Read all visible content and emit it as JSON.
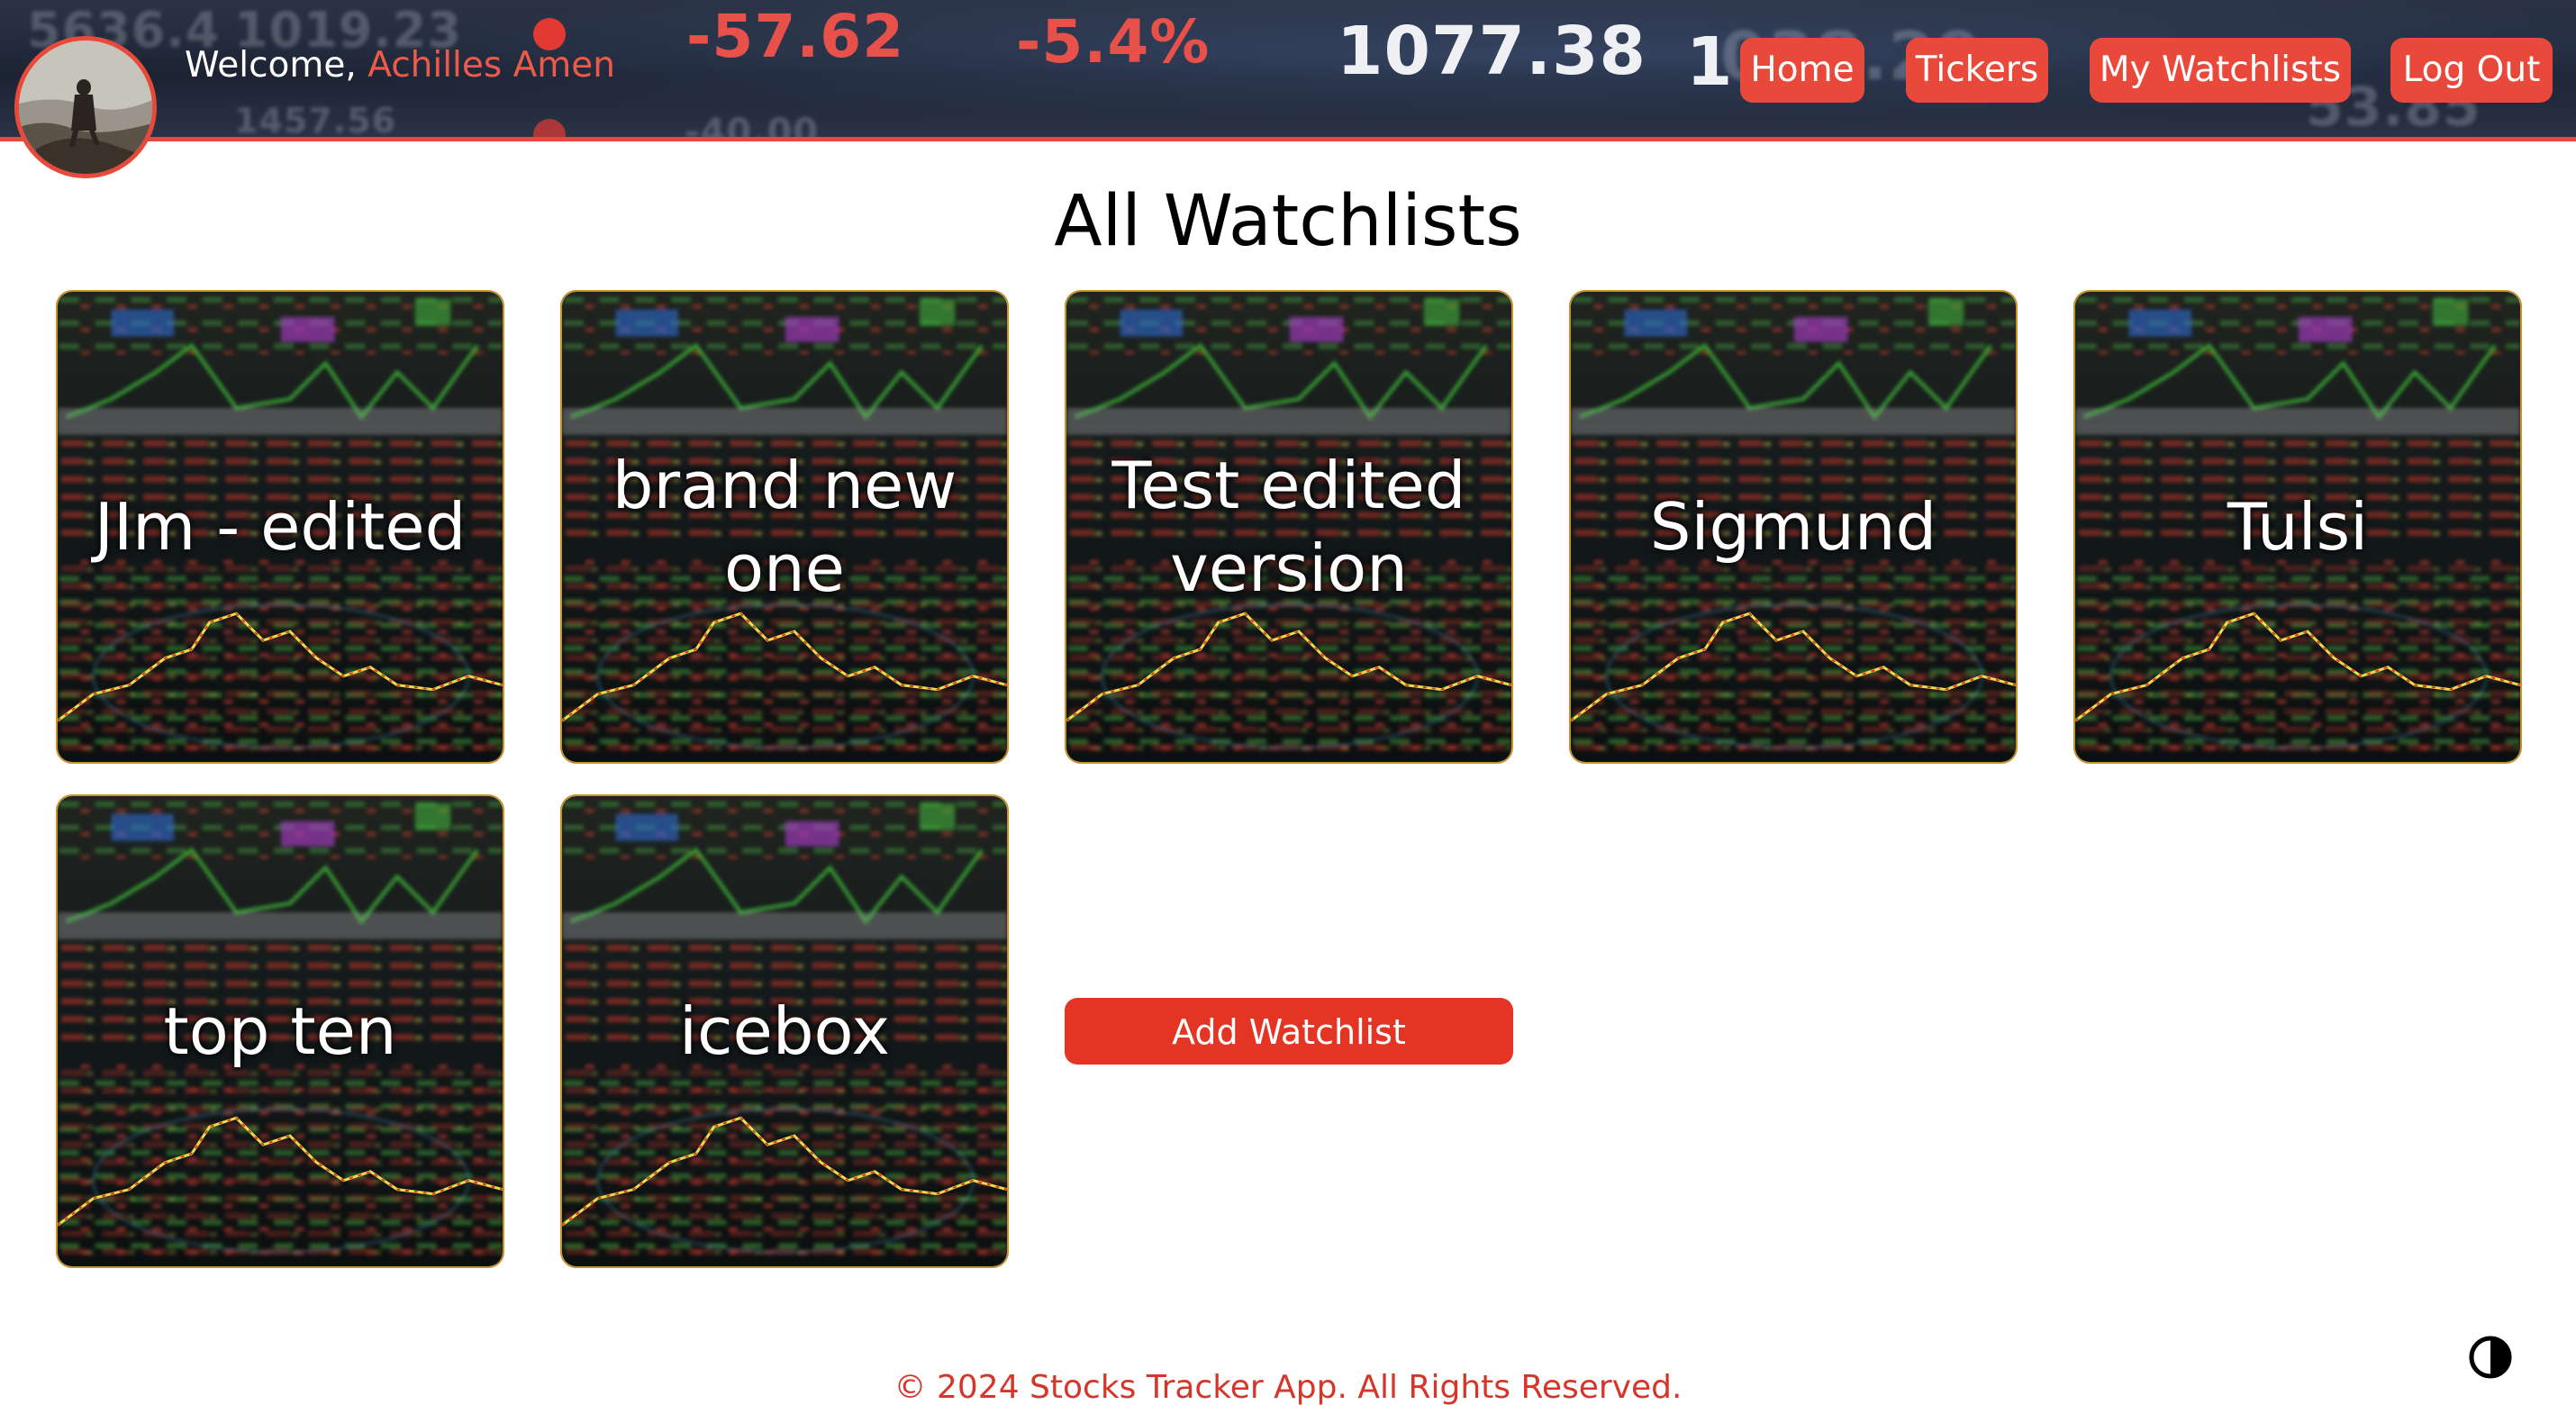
{
  "header": {
    "welcome_prefix": "Welcome,",
    "user_name": "Achilles Amen",
    "ticker_values": [
      "-57.62",
      "-5.4%",
      "1077.38"
    ],
    "nav": {
      "home": "Home",
      "tickers": "Tickers",
      "my_watchlists": "My Watchlists",
      "log_out": "Log Out"
    }
  },
  "main": {
    "title": "All Watchlists",
    "watchlists": [
      {
        "name": "JIm - edited"
      },
      {
        "name": "brand new one"
      },
      {
        "name": "Test edited version"
      },
      {
        "name": "Sigmund"
      },
      {
        "name": "Tulsi"
      },
      {
        "name": "top ten"
      },
      {
        "name": "icebox"
      }
    ],
    "add_button": "Add Watchlist"
  },
  "footer": {
    "text": "© 2024 Stocks Tracker App. All Rights Reserved."
  },
  "icons": {
    "avatar": "avatar",
    "theme_toggle": "contrast-icon"
  },
  "colors": {
    "accent": "#e8493b",
    "button": "#e33424",
    "footer_text": "#d6362a",
    "card_border": "#c8912e",
    "header_bg": "#1c2333"
  }
}
